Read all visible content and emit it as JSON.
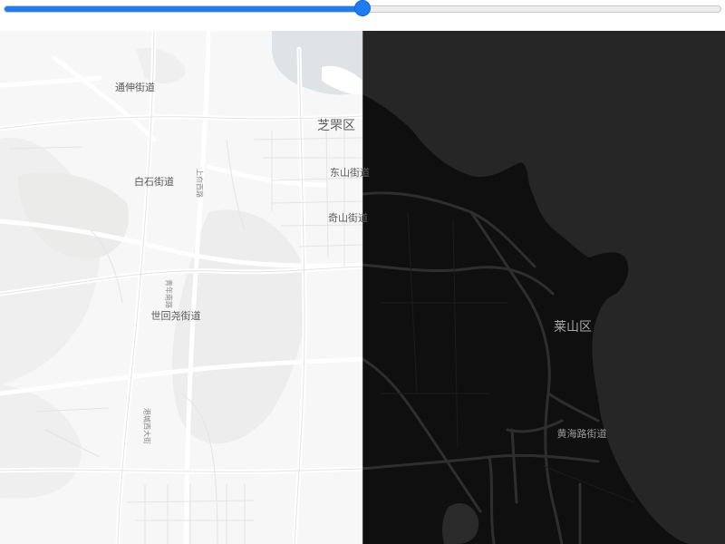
{
  "swipe_slider": {
    "value_percent": 50,
    "accent_color": "#1e7bf0"
  },
  "map": {
    "left_style": "light",
    "right_style": "dark",
    "labels": {
      "tongshen": "通伸街道",
      "zhifu": "芝罘区",
      "baishi": "白石街道",
      "dongshan": "东山街道",
      "qishan": "奇山街道",
      "shihuizhuang": "世回尧街道",
      "laishan": "莱山区",
      "huanghai": "黄海路街道",
      "road_1": "上夼西路",
      "road_2": "青年南路",
      "road_3": "港城西大街"
    }
  }
}
